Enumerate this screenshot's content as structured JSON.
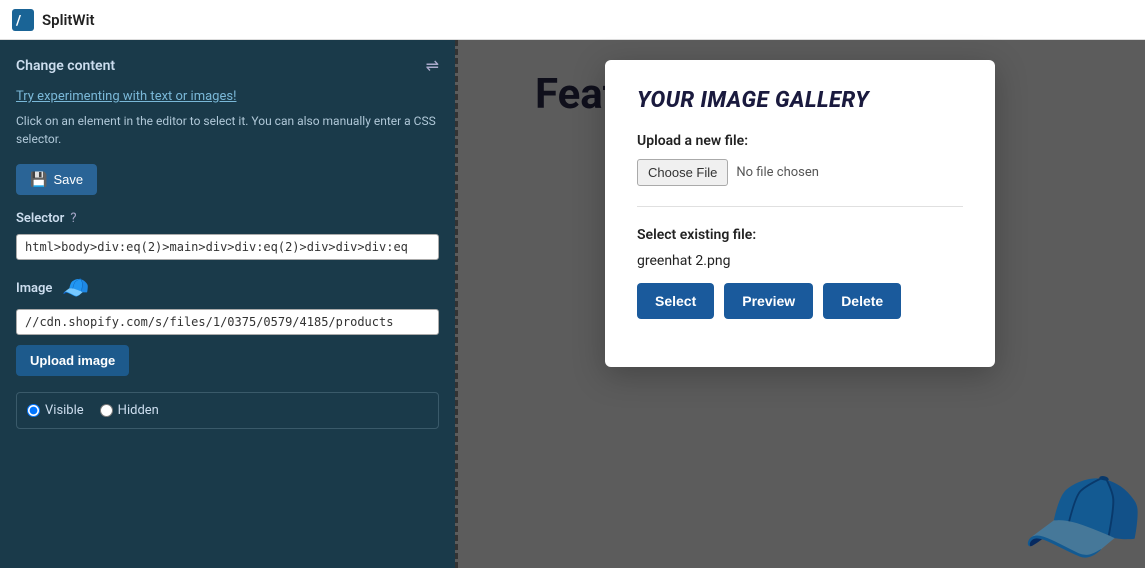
{
  "topbar": {
    "brand": "SplitWit",
    "logo_symbol": "/"
  },
  "left_panel": {
    "title": "Change content",
    "try_link": "Try experimenting with text or images!",
    "hint": "Click on an element in the editor to select it. You can also manually enter a CSS selector.",
    "save_label": "Save",
    "selector_label": "Selector",
    "selector_value": "html>body>div:eq(2)>main>div>div:eq(2)>div>div>div:eq",
    "image_label": "Image",
    "image_url": "//cdn.shopify.com/s/files/1/0375/0579/4185/products",
    "upload_btn_label": "Upload image",
    "visible_label": "Visible",
    "hidden_label": "Hidden"
  },
  "editor": {
    "featured_text": "Featured colle"
  },
  "modal": {
    "title": "YOUR IMAGE GALLERY",
    "upload_label": "Upload a new file:",
    "choose_file_btn": "Choose File",
    "no_file_text": "No file chosen",
    "existing_label": "Select existing file:",
    "filename": "greenhat 2.png",
    "select_btn": "Select",
    "preview_btn": "Preview",
    "delete_btn": "Delete"
  }
}
